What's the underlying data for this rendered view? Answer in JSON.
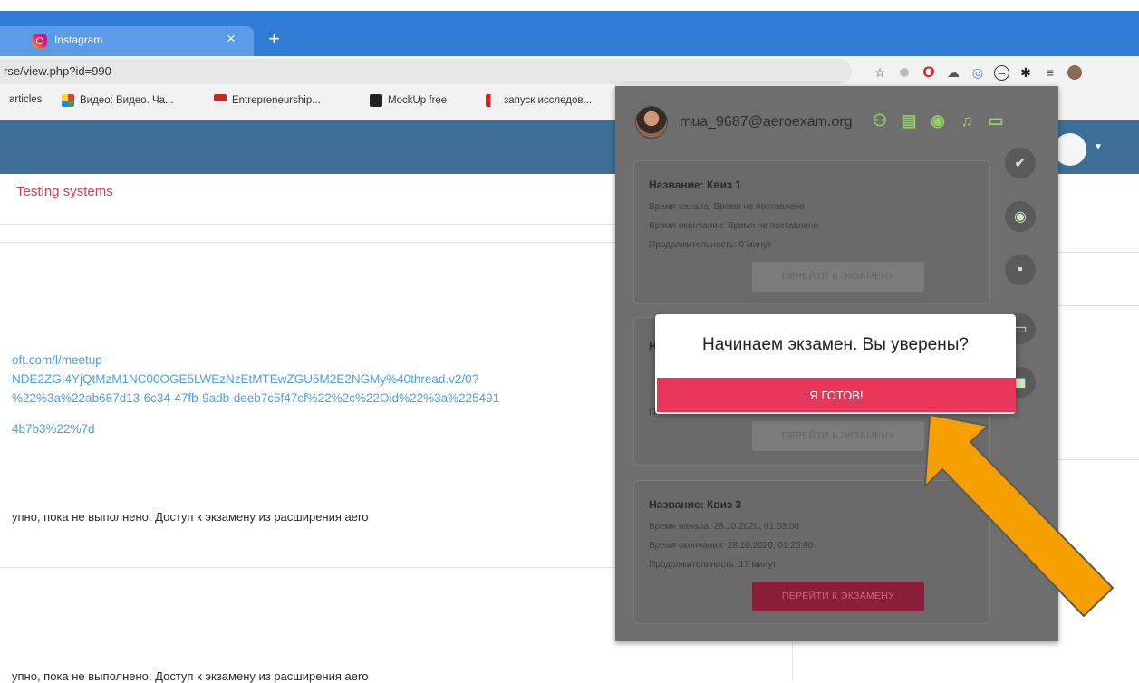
{
  "browser": {
    "tab_title": "Instagram",
    "tab_close": "×",
    "new_tab": "+",
    "url": "rse/view.php?id=990",
    "bookmarks": [
      "articles",
      "Видео: Видео. Ча...",
      "Entrepreneurship...",
      "MockUp free",
      "запуск исследов..."
    ]
  },
  "page": {
    "breadcrumb": "Testing systems",
    "link_lines": [
      "oft.com/l/meetup-",
      "NDE2ZGI4YjQtMzM1NC00OGE5LWEzNzEtMTEwZGU5M2E2NGMy%40thread.v2/0?",
      "%22%3a%22ab687d13-6c34-47fb-9adb-deeb7c5f47cf%22%2c%22Oid%22%3a%225491",
      "4b7b3%22%7d"
    ],
    "restriction_1": "упно, пока не выполнено: Доступ к экзамену из расширения aero",
    "restriction_2": "упно, пока не выполнено: Доступ к экзамену из расширения aero"
  },
  "extension": {
    "email": "mua_9687@aeroexam.org",
    "card1": {
      "title": "Название: Квиз 1",
      "start": "Время начала: Время не поставлено",
      "end": "Время окончания: Время не поставлено",
      "duration": "Продолжительность: 0 минут",
      "button": "ПЕРЕЙТИ К ЭКЗАМЕНУ"
    },
    "card2": {
      "title_fragment": "Н",
      "duration_fragment": "П",
      "button": "ПЕРЕЙТИ К ЭКЗАМЕНУ"
    },
    "card3": {
      "title": "Название: Квиз 3",
      "start": "Время начала: 28.10.2020, 01:03:00",
      "end": "Время окончания: 28.10.2020, 01:20:00",
      "duration": "Продолжительность: 17 минут",
      "button": "ПЕРЕЙТИ К ЭКЗАМЕНУ"
    }
  },
  "modal": {
    "title": "Начинаем экзамен. Вы уверены?",
    "confirm": "Я ГОТОВ!"
  },
  "colors": {
    "accent": "#e8365a",
    "navbar": "#3c6f97",
    "arrow": "#f5a000"
  }
}
